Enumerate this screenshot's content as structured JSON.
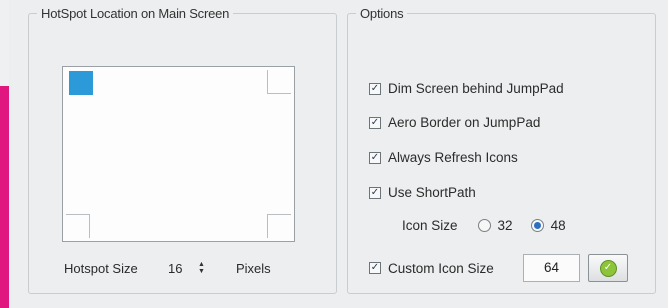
{
  "hotspot_group": {
    "title": "HotSpot Location on Main Screen",
    "size_label": "Hotspot Size",
    "size_value": "16",
    "size_unit": "Pixels",
    "selected_corner": "top-left"
  },
  "options_group": {
    "title": "Options",
    "dim_screen": {
      "label": "Dim Screen behind JumpPad",
      "checked": true
    },
    "aero_border": {
      "label": "Aero Border on JumpPad",
      "checked": true
    },
    "always_refresh": {
      "label": "Always Refresh Icons",
      "checked": true
    },
    "use_shortpath": {
      "label": "Use ShortPath",
      "checked": true
    },
    "icon_size": {
      "label": "Icon Size",
      "options": [
        "32",
        "48"
      ],
      "selected": "48"
    },
    "custom_icon_size": {
      "label": "Custom Icon Size",
      "checked": true,
      "value": "64"
    }
  },
  "colors": {
    "accent_blue": "#2c9ad9",
    "brand_pink": "#e0177f",
    "ok_green": "#8dc43a"
  }
}
